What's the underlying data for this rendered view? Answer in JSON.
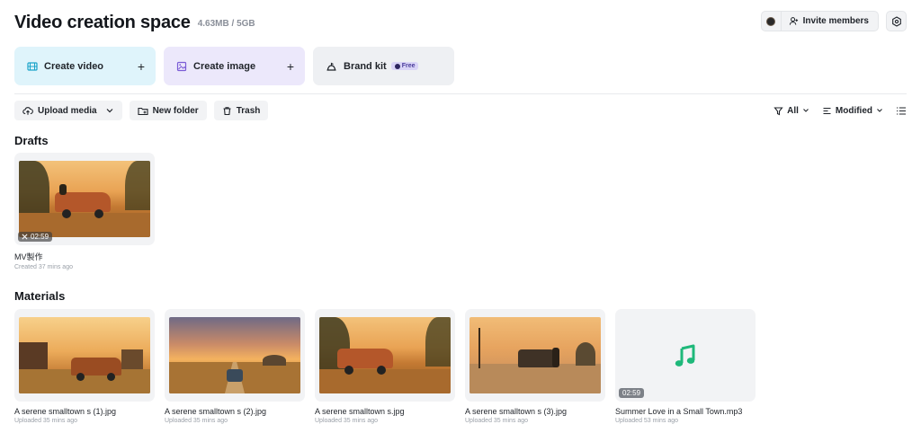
{
  "header": {
    "title": "Video creation space",
    "storage": "4.63MB / 5GB",
    "invite_label": "Invite members"
  },
  "create": {
    "video_label": "Create video",
    "image_label": "Create image",
    "brand_label": "Brand kit",
    "brand_badge": "Free"
  },
  "toolbar": {
    "upload_label": "Upload media",
    "new_folder_label": "New folder",
    "trash_label": "Trash",
    "filter_label": "All",
    "sort_label": "Modified"
  },
  "drafts": {
    "title": "Drafts",
    "items": [
      {
        "name": "MV製作",
        "meta": "Created 37 mins ago",
        "duration": "02:59"
      }
    ]
  },
  "materials": {
    "title": "Materials",
    "items": [
      {
        "name": "A serene smalltown s (1).jpg",
        "meta": "Uploaded 35 mins ago"
      },
      {
        "name": "A serene smalltown s (2).jpg",
        "meta": "Uploaded 35 mins ago"
      },
      {
        "name": "A serene smalltown s.jpg",
        "meta": "Uploaded 35 mins ago"
      },
      {
        "name": "A serene smalltown s (3).jpg",
        "meta": "Uploaded 35 mins ago"
      },
      {
        "name": "Summer Love in a Small Town.mp3",
        "meta": "Uploaded 53 mins ago",
        "duration": "02:59"
      }
    ]
  },
  "colors": {
    "accent_video": "#dff4fb",
    "accent_image": "#ece8fb",
    "music_icon": "#1fb87a"
  }
}
